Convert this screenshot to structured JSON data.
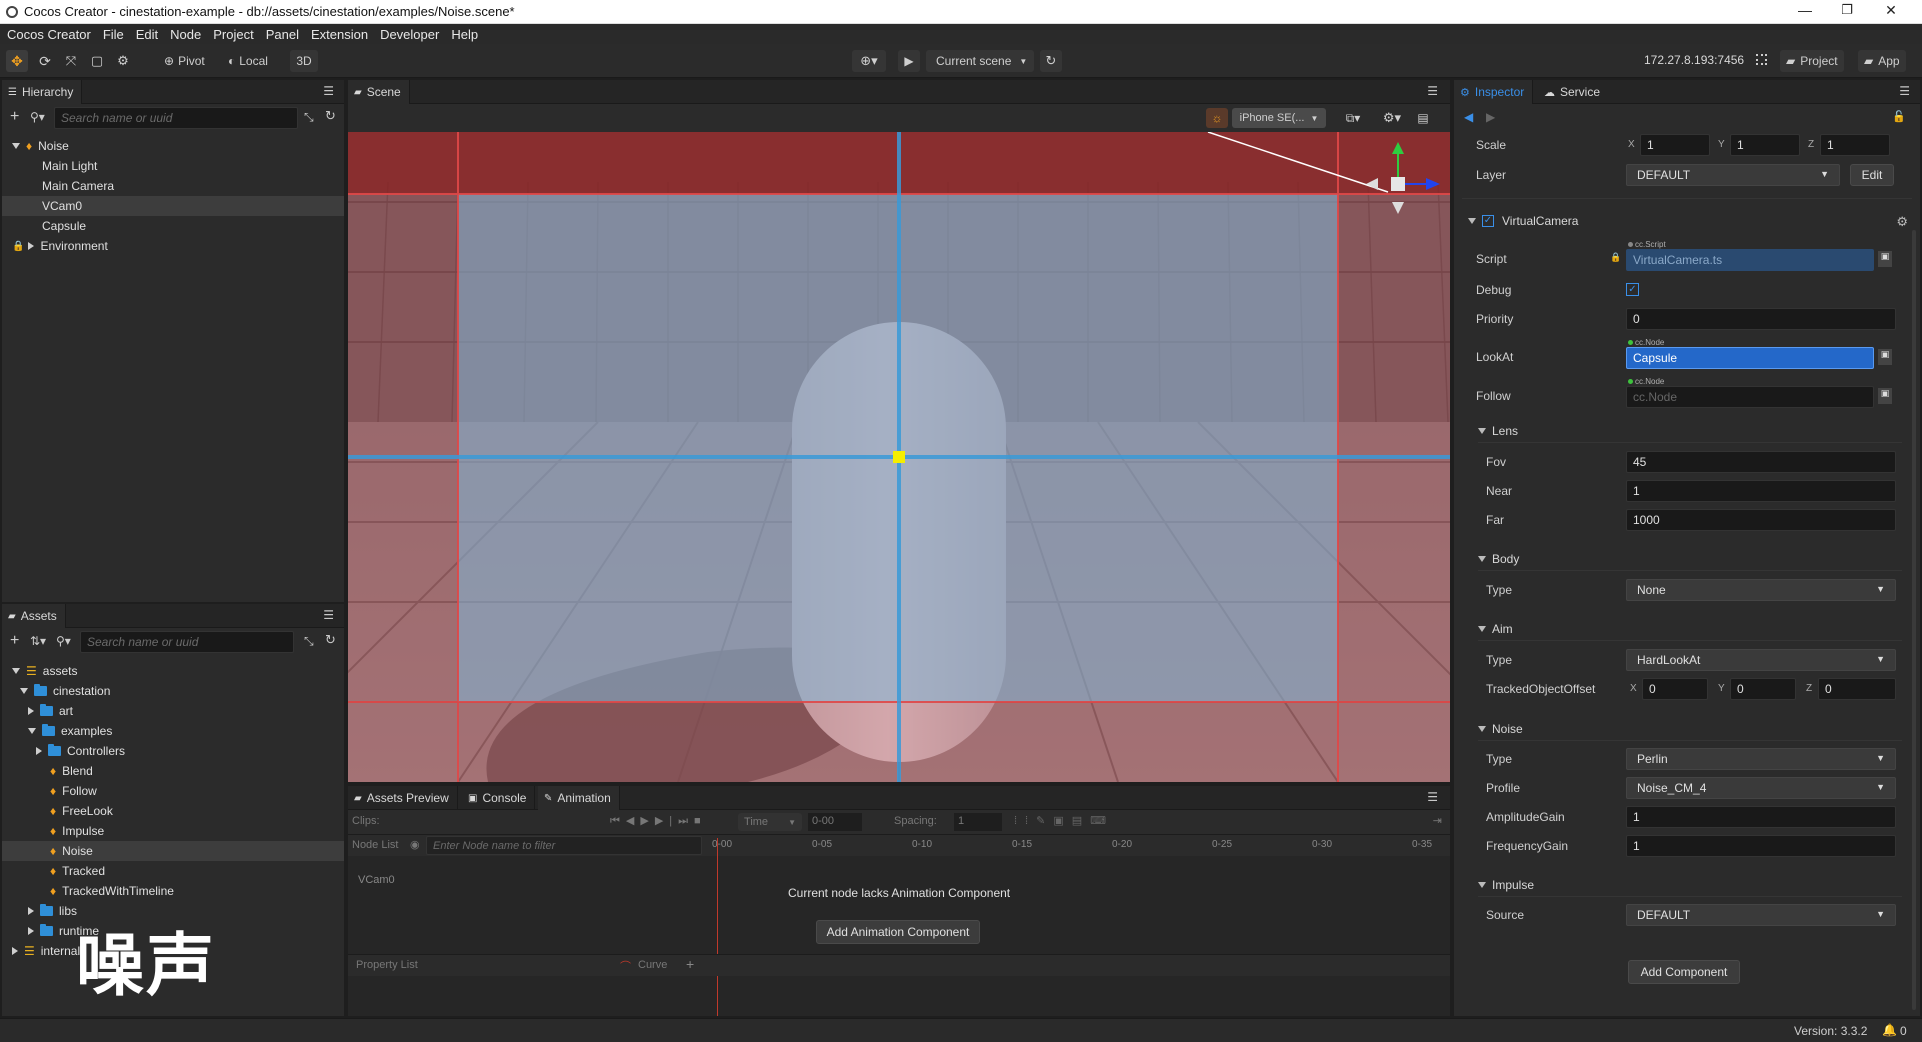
{
  "window": {
    "title": "Cocos Creator - cinestation-example - db://assets/cinestation/examples/Noise.scene*",
    "controls": [
      "—",
      "❐",
      "✕"
    ]
  },
  "menu": [
    "Cocos Creator",
    "File",
    "Edit",
    "Node",
    "Project",
    "Panel",
    "Extension",
    "Developer",
    "Help"
  ],
  "toolbar": {
    "pivot_label": "Pivot",
    "local_label": "Local",
    "mode_3d_label": "3D",
    "scene_select": "Current scene",
    "ip": "172.27.8.193:7456",
    "project_label": "Project",
    "app_label": "App"
  },
  "hierarchy": {
    "tab": "Hierarchy",
    "search_placeholder": "Search name or uuid",
    "items": [
      {
        "label": "Noise"
      },
      {
        "label": "Main Light"
      },
      {
        "label": "Main Camera"
      },
      {
        "label": "VCam0"
      },
      {
        "label": "Capsule"
      },
      {
        "label": "Environment"
      }
    ]
  },
  "assets": {
    "tab": "Assets",
    "search_placeholder": "Search name or uuid",
    "items": [
      {
        "label": "assets"
      },
      {
        "label": "cinestation"
      },
      {
        "label": "art"
      },
      {
        "label": "examples"
      },
      {
        "label": "Controllers"
      },
      {
        "label": "Blend"
      },
      {
        "label": "Follow"
      },
      {
        "label": "FreeLook"
      },
      {
        "label": "Impulse"
      },
      {
        "label": "Noise"
      },
      {
        "label": "Tracked"
      },
      {
        "label": "TrackedWithTimeline"
      },
      {
        "label": "libs"
      },
      {
        "label": "runtime"
      },
      {
        "label": "internal"
      }
    ],
    "overlay_text": "噪声"
  },
  "scene": {
    "tab": "Scene",
    "device": "iPhone SE(..."
  },
  "bottom": {
    "tabs": [
      "Assets Preview",
      "Console",
      "Animation"
    ],
    "clips_label": "Clips:",
    "time_mode": "Time",
    "time_value": "0-00",
    "spacing_label": "Spacing:",
    "spacing_value": "1",
    "node_list_label": "Node List",
    "node_filter_placeholder": "Enter Node name to filter",
    "ticks": [
      "0-00",
      "0-05",
      "0-10",
      "0-15",
      "0-20",
      "0-25",
      "0-30",
      "0-35"
    ],
    "node_name": "VCam0",
    "message": "Current node lacks Animation Component",
    "add_anim_button": "Add Animation Component",
    "property_list_label": "Property List",
    "curve_label": "Curve"
  },
  "inspector": {
    "tabs": [
      "Inspector",
      "Service"
    ],
    "scale_label": "Scale",
    "scale": {
      "x": "1",
      "y": "1",
      "z": "1"
    },
    "layer_label": "Layer",
    "layer_value": "DEFAULT",
    "edit_button": "Edit",
    "component_name": "VirtualCamera",
    "script_label": "Script",
    "script_tag": "cc.Script",
    "script_value": "VirtualCamera.ts",
    "debug_label": "Debug",
    "priority_label": "Priority",
    "priority_value": "0",
    "lookat_label": "LookAt",
    "lookat_tag": "cc.Node",
    "lookat_value": "Capsule",
    "follow_label": "Follow",
    "follow_tag": "cc.Node",
    "follow_value": "cc.Node",
    "lens_label": "Lens",
    "fov_label": "Fov",
    "fov_value": "45",
    "near_label": "Near",
    "near_value": "1",
    "far_label": "Far",
    "far_value": "1000",
    "body_label": "Body",
    "body_type_label": "Type",
    "body_type_value": "None",
    "aim_label": "Aim",
    "aim_type_label": "Type",
    "aim_type_value": "HardLookAt",
    "tracked_offset_label": "TrackedObjectOffset",
    "tracked_offset": {
      "x": "0",
      "y": "0",
      "z": "0"
    },
    "noise_label": "Noise",
    "noise_type_label": "Type",
    "noise_type_value": "Perlin",
    "profile_label": "Profile",
    "profile_value": "Noise_CM_4",
    "amplitude_label": "AmplitudeGain",
    "amplitude_value": "1",
    "frequency_label": "FrequencyGain",
    "frequency_value": "1",
    "impulse_label": "Impulse",
    "source_label": "Source",
    "source_value": "DEFAULT",
    "add_component_button": "Add Component"
  },
  "status": {
    "version": "Version: 3.3.2",
    "notif_count": "0"
  },
  "colors": {
    "accent": "#2f7fd8",
    "selection": "#2468c9",
    "icon_orange": "#f0a020"
  }
}
